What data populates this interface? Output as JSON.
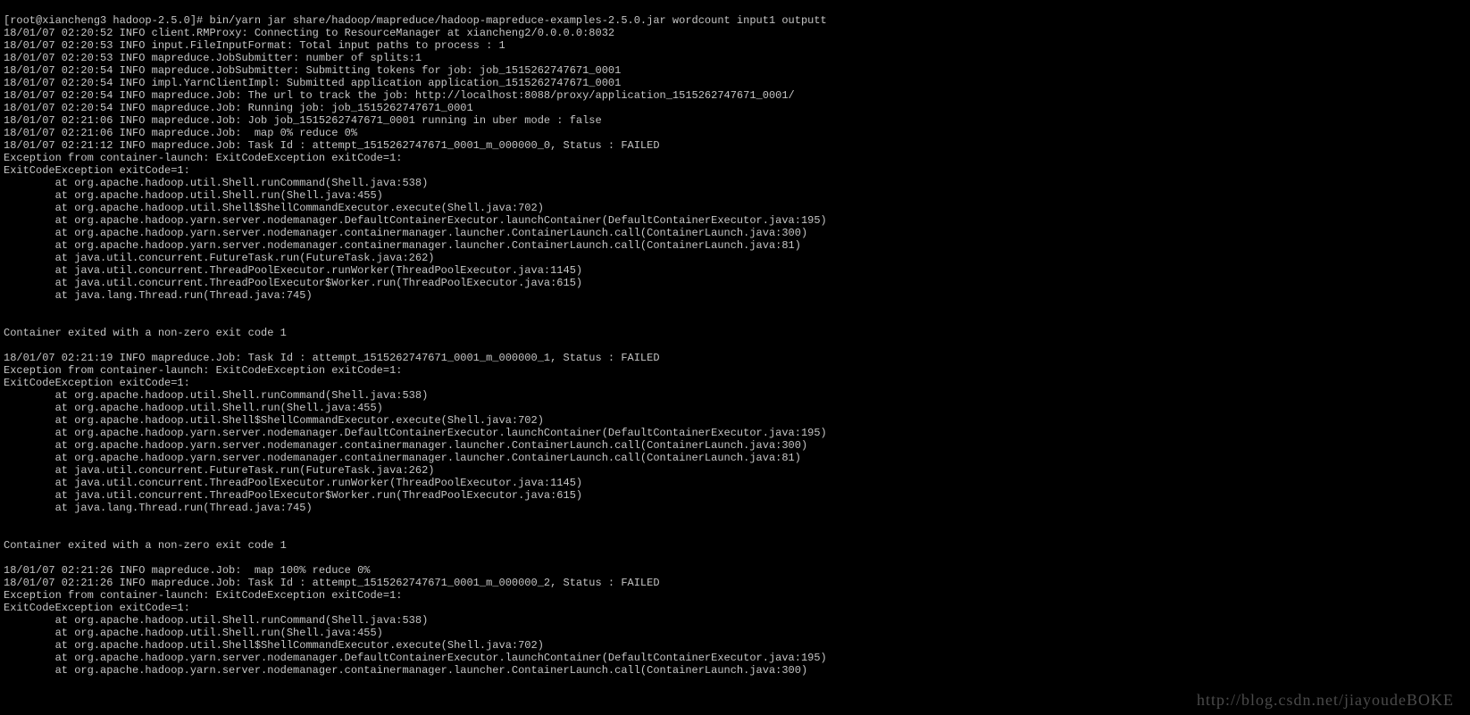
{
  "prompt": "[root@xiancheng3 hadoop-2.5.0]# bin/yarn jar share/hadoop/mapreduce/hadoop-mapreduce-examples-2.5.0.jar wordcount input1 outputt",
  "lines": [
    "18/01/07 02:20:52 INFO client.RMProxy: Connecting to ResourceManager at xiancheng2/0.0.0.0:8032",
    "18/01/07 02:20:53 INFO input.FileInputFormat: Total input paths to process : 1",
    "18/01/07 02:20:53 INFO mapreduce.JobSubmitter: number of splits:1",
    "18/01/07 02:20:54 INFO mapreduce.JobSubmitter: Submitting tokens for job: job_1515262747671_0001",
    "18/01/07 02:20:54 INFO impl.YarnClientImpl: Submitted application application_1515262747671_0001",
    "18/01/07 02:20:54 INFO mapreduce.Job: The url to track the job: http://localhost:8088/proxy/application_1515262747671_0001/",
    "18/01/07 02:20:54 INFO mapreduce.Job: Running job: job_1515262747671_0001",
    "18/01/07 02:21:06 INFO mapreduce.Job: Job job_1515262747671_0001 running in uber mode : false",
    "18/01/07 02:21:06 INFO mapreduce.Job:  map 0% reduce 0%",
    "18/01/07 02:21:12 INFO mapreduce.Job: Task Id : attempt_1515262747671_0001_m_000000_0, Status : FAILED",
    "Exception from container-launch: ExitCodeException exitCode=1:",
    "ExitCodeException exitCode=1:",
    "        at org.apache.hadoop.util.Shell.runCommand(Shell.java:538)",
    "        at org.apache.hadoop.util.Shell.run(Shell.java:455)",
    "        at org.apache.hadoop.util.Shell$ShellCommandExecutor.execute(Shell.java:702)",
    "        at org.apache.hadoop.yarn.server.nodemanager.DefaultContainerExecutor.launchContainer(DefaultContainerExecutor.java:195)",
    "        at org.apache.hadoop.yarn.server.nodemanager.containermanager.launcher.ContainerLaunch.call(ContainerLaunch.java:300)",
    "        at org.apache.hadoop.yarn.server.nodemanager.containermanager.launcher.ContainerLaunch.call(ContainerLaunch.java:81)",
    "        at java.util.concurrent.FutureTask.run(FutureTask.java:262)",
    "        at java.util.concurrent.ThreadPoolExecutor.runWorker(ThreadPoolExecutor.java:1145)",
    "        at java.util.concurrent.ThreadPoolExecutor$Worker.run(ThreadPoolExecutor.java:615)",
    "        at java.lang.Thread.run(Thread.java:745)",
    "",
    "",
    "Container exited with a non-zero exit code 1",
    "",
    "18/01/07 02:21:19 INFO mapreduce.Job: Task Id : attempt_1515262747671_0001_m_000000_1, Status : FAILED",
    "Exception from container-launch: ExitCodeException exitCode=1:",
    "ExitCodeException exitCode=1:",
    "        at org.apache.hadoop.util.Shell.runCommand(Shell.java:538)",
    "        at org.apache.hadoop.util.Shell.run(Shell.java:455)",
    "        at org.apache.hadoop.util.Shell$ShellCommandExecutor.execute(Shell.java:702)",
    "        at org.apache.hadoop.yarn.server.nodemanager.DefaultContainerExecutor.launchContainer(DefaultContainerExecutor.java:195)",
    "        at org.apache.hadoop.yarn.server.nodemanager.containermanager.launcher.ContainerLaunch.call(ContainerLaunch.java:300)",
    "        at org.apache.hadoop.yarn.server.nodemanager.containermanager.launcher.ContainerLaunch.call(ContainerLaunch.java:81)",
    "        at java.util.concurrent.FutureTask.run(FutureTask.java:262)",
    "        at java.util.concurrent.ThreadPoolExecutor.runWorker(ThreadPoolExecutor.java:1145)",
    "        at java.util.concurrent.ThreadPoolExecutor$Worker.run(ThreadPoolExecutor.java:615)",
    "        at java.lang.Thread.run(Thread.java:745)",
    "",
    "",
    "Container exited with a non-zero exit code 1",
    "",
    "18/01/07 02:21:26 INFO mapreduce.Job:  map 100% reduce 0%",
    "18/01/07 02:21:26 INFO mapreduce.Job: Task Id : attempt_1515262747671_0001_m_000000_2, Status : FAILED",
    "Exception from container-launch: ExitCodeException exitCode=1:",
    "ExitCodeException exitCode=1:",
    "        at org.apache.hadoop.util.Shell.runCommand(Shell.java:538)",
    "        at org.apache.hadoop.util.Shell.run(Shell.java:455)",
    "        at org.apache.hadoop.util.Shell$ShellCommandExecutor.execute(Shell.java:702)",
    "        at org.apache.hadoop.yarn.server.nodemanager.DefaultContainerExecutor.launchContainer(DefaultContainerExecutor.java:195)",
    "        at org.apache.hadoop.yarn.server.nodemanager.containermanager.launcher.ContainerLaunch.call(ContainerLaunch.java:300)"
  ],
  "watermark": "http://blog.csdn.net/jiayoudeBOKE"
}
